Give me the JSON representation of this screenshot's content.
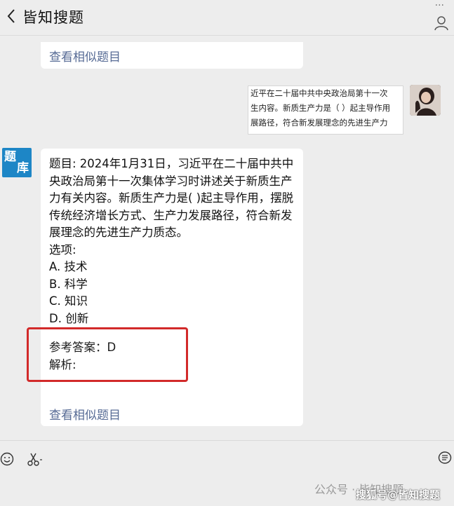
{
  "header": {
    "title": "皆知搜题",
    "window_dots": "···"
  },
  "top_bubble": {
    "link": "查看相似题目"
  },
  "user_image": {
    "lines": [
      "近平在二十届中共中央政治局第十一次",
      "生内容。新质生产力是（ ）起主导作用",
      "展路径，符合新发展理念的先进生产力"
    ]
  },
  "bot": {
    "avatar_text": [
      "题",
      "库"
    ],
    "question": "题目: 2024年1月31日，习近平在二十届中共中央政治局第十一次集体学习时讲述关于新质生产力有关内容。新质生产力是( )起主导作用，摆脱传统经济增长方式、生产力发展路径，符合新发展理念的先进生产力质态。",
    "options_label": "选项:",
    "options": [
      "A. 技术",
      "B. 科学",
      "C. 知识",
      "D. 创新"
    ],
    "answer": "参考答案：D",
    "analysis": "解析:",
    "link": "查看相似题目"
  },
  "watermark": {
    "line1": "公众号 · 皆知搜题",
    "line2": "搜狐号@皆知搜题"
  },
  "colors": {
    "link": "#576b95",
    "highlight_box": "#d22a2a",
    "avatar_bg": "#1d86c6"
  }
}
